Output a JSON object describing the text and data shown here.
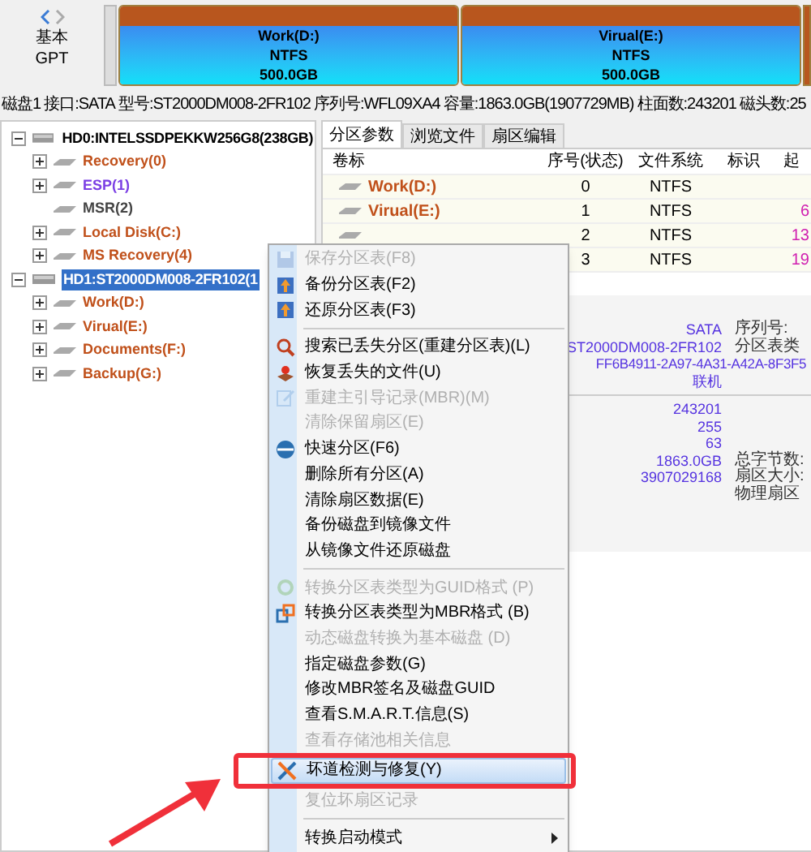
{
  "disk_map": {
    "disk_type": "基本",
    "partition_style": "GPT",
    "partitions": [
      {
        "name": "Work(D:)",
        "filesystem": "NTFS",
        "size": "500.0GB"
      },
      {
        "name": "Virual(E:)",
        "filesystem": "NTFS",
        "size": "500.0GB"
      }
    ]
  },
  "info_bar": [
    "磁盘1",
    "接口:SATA",
    "型号:ST2000DM008-2FR102",
    "序列号:WFL09XA4",
    "容量:1863.0GB(1907729MB)",
    "柱面数:243201",
    "磁头数:25"
  ],
  "tree": [
    {
      "label": "HD0:INTELSSDPEKKW256G8(238GB)",
      "selected": false,
      "expanded": true,
      "children": [
        {
          "label": "Recovery(0)",
          "color": "#c0501a",
          "expandable": true
        },
        {
          "label": "ESP(1)",
          "color": "#7b3fe4",
          "expandable": true
        },
        {
          "label": "MSR(2)",
          "color": "#444444",
          "expandable": false
        },
        {
          "label": "Local Disk(C:)",
          "color": "#c0501a",
          "expandable": true
        },
        {
          "label": "MS Recovery(4)",
          "color": "#c0501a",
          "expandable": true
        }
      ]
    },
    {
      "label": "HD1:ST2000DM008-2FR102(1",
      "selected": true,
      "expanded": true,
      "children": [
        {
          "label": "Work(D:)",
          "color": "#c0501a",
          "expandable": true
        },
        {
          "label": "Virual(E:)",
          "color": "#c0501a",
          "expandable": true
        },
        {
          "label": "Documents(F:)",
          "color": "#c0501a",
          "expandable": true
        },
        {
          "label": "Backup(G:)",
          "color": "#c0501a",
          "expandable": true
        }
      ]
    }
  ],
  "tabs": [
    {
      "label": "分区参数",
      "selected": true
    },
    {
      "label": "浏览文件",
      "selected": false
    },
    {
      "label": "扇区编辑",
      "selected": false
    }
  ],
  "table": {
    "columns": [
      "卷标",
      "序号(状态)",
      "文件系统",
      "标识",
      "起"
    ],
    "rows": [
      {
        "label": "Work(D:)",
        "index": "0",
        "filesystem": "NTFS",
        "column_5": ""
      },
      {
        "label": "Virual(E:)",
        "index": "1",
        "filesystem": "NTFS",
        "column_5": "6"
      },
      {
        "label": "",
        "index": "2",
        "filesystem": "NTFS",
        "column_5": "13"
      },
      {
        "label": "",
        "index": "3",
        "filesystem": "NTFS",
        "column_5": "19"
      }
    ]
  },
  "details": {
    "group_1": [
      "SATA",
      "ST2000DM008-2FR102",
      "FF6B4911-2A97-4A31-A42A-8F3F5",
      "联机"
    ],
    "group_1_labels": [
      "序列号:",
      "分区表类"
    ],
    "group_2": [
      "243201",
      "255",
      "63",
      "1863.0GB",
      "3907029168"
    ],
    "group_2_labels": [
      "总字节数:",
      "扇区大小:",
      "物理扇区"
    ]
  },
  "context_menu": [
    {
      "kind": "item",
      "label": "保存分区表(F8)",
      "disabled": true,
      "selected": false,
      "submenu": false
    },
    {
      "kind": "item",
      "label": "备份分区表(F2)",
      "disabled": false,
      "selected": false,
      "submenu": false
    },
    {
      "kind": "item",
      "label": "还原分区表(F3)",
      "disabled": false,
      "selected": false,
      "submenu": false
    },
    {
      "kind": "separator"
    },
    {
      "kind": "item",
      "label": "搜索已丢失分区(重建分区表)(L)",
      "disabled": false,
      "selected": false,
      "submenu": false
    },
    {
      "kind": "item",
      "label": "恢复丢失的文件(U)",
      "disabled": false,
      "selected": false,
      "submenu": false
    },
    {
      "kind": "item",
      "label": "重建主引导记录(MBR)(M)",
      "disabled": true,
      "selected": false,
      "submenu": false
    },
    {
      "kind": "item",
      "label": "清除保留扇区(E)",
      "disabled": true,
      "selected": false,
      "submenu": false
    },
    {
      "kind": "item",
      "label": "快速分区(F6)",
      "disabled": false,
      "selected": false,
      "submenu": false
    },
    {
      "kind": "item",
      "label": "删除所有分区(A)",
      "disabled": false,
      "selected": false,
      "submenu": false
    },
    {
      "kind": "item",
      "label": "清除扇区数据(E)",
      "disabled": false,
      "selected": false,
      "submenu": false
    },
    {
      "kind": "item",
      "label": "备份磁盘到镜像文件",
      "disabled": false,
      "selected": false,
      "submenu": false
    },
    {
      "kind": "item",
      "label": "从镜像文件还原磁盘",
      "disabled": false,
      "selected": false,
      "submenu": false
    },
    {
      "kind": "separator"
    },
    {
      "kind": "item",
      "label": "转换分区表类型为GUID格式 (P)",
      "disabled": true,
      "selected": false,
      "submenu": false
    },
    {
      "kind": "item",
      "label": "转换分区表类型为MBR格式 (B)",
      "disabled": false,
      "selected": false,
      "submenu": false
    },
    {
      "kind": "item",
      "label": "动态磁盘转换为基本磁盘 (D)",
      "disabled": true,
      "selected": false,
      "submenu": false
    },
    {
      "kind": "item",
      "label": "指定磁盘参数(G)",
      "disabled": false,
      "selected": false,
      "submenu": false
    },
    {
      "kind": "item",
      "label": "修改MBR签名及磁盘GUID",
      "disabled": false,
      "selected": false,
      "submenu": false
    },
    {
      "kind": "item",
      "label": "查看S.M.A.R.T.信息(S)",
      "disabled": false,
      "selected": false,
      "submenu": false
    },
    {
      "kind": "item",
      "label": "查看存储池相关信息",
      "disabled": true,
      "selected": false,
      "submenu": false
    },
    {
      "kind": "item",
      "label": "坏道检测与修复(Y)",
      "disabled": false,
      "selected": true,
      "submenu": false
    },
    {
      "kind": "item",
      "label": "复位坏扇区记录",
      "disabled": true,
      "selected": false,
      "submenu": false
    },
    {
      "kind": "separator"
    },
    {
      "kind": "item",
      "label": "转换启动模式",
      "disabled": false,
      "selected": false,
      "submenu": true
    }
  ]
}
